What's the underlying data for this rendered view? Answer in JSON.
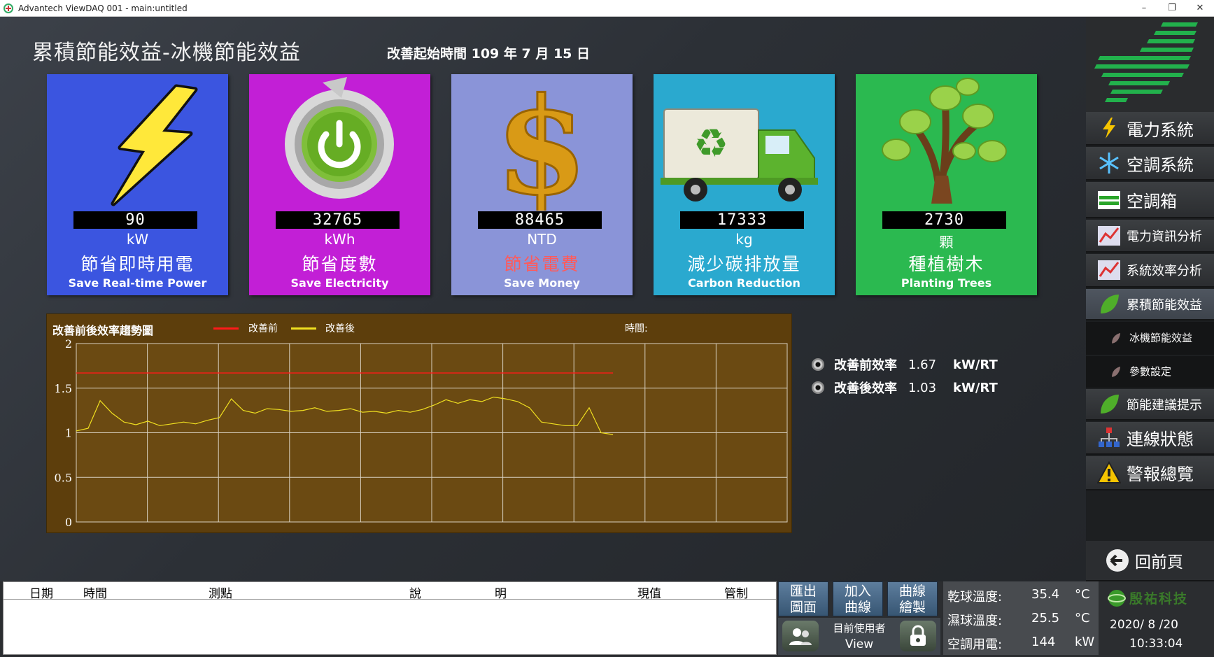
{
  "window": {
    "title": "Advantech ViewDAQ 001 - main:untitled",
    "minimize": "–",
    "restore": "❐",
    "close": "✕"
  },
  "header": {
    "title": "累積節能效益-冰機節能效益",
    "start_label": "改善起始時間 109 年 7 月 15 日"
  },
  "cards": [
    {
      "value": "90",
      "unit": "kW",
      "zh": "節省即時用電",
      "en": "Save Real-time Power",
      "color": "#3b55e0",
      "icon": "lightning-bolt-icon"
    },
    {
      "value": "32765",
      "unit": "kWh",
      "zh": "節省度數",
      "en": "Save Electricity",
      "color": "#c21fd6",
      "icon": "power-button-icon"
    },
    {
      "value": "88465",
      "unit": "NTD",
      "zh": "節省電費",
      "en": "Save Money",
      "color": "#8a94d8",
      "icon": "dollar-icon"
    },
    {
      "value": "17333",
      "unit": "kg",
      "zh": "減少碳排放量",
      "en": "Carbon Reduction",
      "color": "#2aa9cf",
      "icon": "recycle-truck-icon"
    },
    {
      "value": "2730",
      "unit": "顆",
      "zh": "種植樹木",
      "en": "Planting Trees",
      "color": "#2bb950",
      "icon": "tree-icon"
    }
  ],
  "chart_data": {
    "type": "line",
    "title": "改善前後效率趨勢圖",
    "time_label": "時間:",
    "ylim": [
      0,
      2
    ],
    "yticks": [
      "0",
      "0.5",
      "1",
      "1.5",
      "2"
    ],
    "series": [
      {
        "name": "改善前",
        "color": "#ff1a1a",
        "values": [
          1.67,
          1.67,
          1.67,
          1.67,
          1.67,
          1.67,
          1.67,
          1.67,
          1.67,
          1.67,
          1.67,
          1.67,
          1.67,
          1.67,
          1.67,
          1.67,
          1.67,
          1.67,
          1.67,
          1.67,
          1.67,
          1.67,
          1.67,
          1.67,
          1.67,
          1.67,
          1.67,
          1.67,
          1.67,
          1.67,
          1.67,
          1.67,
          1.67,
          1.67,
          1.67,
          1.67,
          1.67,
          1.67,
          1.67,
          1.67,
          1.67,
          1.67,
          1.67,
          1.67,
          1.67,
          1.67
        ]
      },
      {
        "name": "改善後",
        "color": "#f0e020",
        "values": [
          1.02,
          1.05,
          1.36,
          1.22,
          1.12,
          1.09,
          1.13,
          1.08,
          1.1,
          1.12,
          1.1,
          1.14,
          1.17,
          1.38,
          1.25,
          1.22,
          1.27,
          1.26,
          1.24,
          1.25,
          1.28,
          1.24,
          1.25,
          1.27,
          1.23,
          1.24,
          1.22,
          1.25,
          1.23,
          1.26,
          1.31,
          1.37,
          1.33,
          1.37,
          1.35,
          1.4,
          1.38,
          1.35,
          1.28,
          1.12,
          1.1,
          1.08,
          1.08,
          1.28,
          1.0,
          0.98
        ]
      }
    ]
  },
  "efficiency": [
    {
      "label": "改善前效率",
      "value": "1.67",
      "unit": "kW/RT"
    },
    {
      "label": "改善後效率",
      "value": "1.03",
      "unit": "kW/RT"
    }
  ],
  "sidebar": {
    "items": [
      {
        "label": "電力系統",
        "icon": "lightning-icon",
        "size": "24px"
      },
      {
        "label": "空調系統",
        "icon": "snowflake-icon",
        "size": "24px"
      },
      {
        "label": "空調箱",
        "icon": "ahu-icon",
        "size": "24px"
      },
      {
        "label": "電力資訊分析",
        "icon": "analysis-chart-icon",
        "size": "18px"
      },
      {
        "label": "系統效率分析",
        "icon": "efficiency-chart-icon",
        "size": "18px"
      },
      {
        "label": "累積節能效益",
        "icon": "leaf-icon",
        "size": "18px",
        "active": true
      },
      {
        "label": "冰機節能效益",
        "icon": "leaf-small-icon",
        "size": "15px",
        "sub": true
      },
      {
        "label": "參數設定",
        "icon": "leaf-small-icon",
        "size": "15px",
        "sub": true
      },
      {
        "label": "節能建議提示",
        "icon": "leaf-icon",
        "size": "18px"
      },
      {
        "label": "連線狀態",
        "icon": "network-icon",
        "size": "24px"
      },
      {
        "label": "警報總覽",
        "icon": "warning-icon",
        "size": "24px"
      }
    ],
    "back": "回前頁"
  },
  "log_table": {
    "headers": [
      "日期",
      "時間",
      "測點",
      "說",
      "明",
      "現值",
      "管制"
    ]
  },
  "buttons": {
    "export": [
      "匯出",
      "圖面"
    ],
    "add_curve": [
      "加入",
      "曲線"
    ],
    "draw_curve": [
      "曲線",
      "繪製"
    ]
  },
  "user": {
    "label": "目前使用者",
    "name": "View"
  },
  "readings": [
    {
      "label": "乾球溫度:",
      "value": "35.4",
      "unit": "°C"
    },
    {
      "label": "濕球溫度:",
      "value": "25.5",
      "unit": "°C"
    },
    {
      "label": "空調用電:",
      "value": "144",
      "unit": "kW"
    }
  ],
  "brand": "殷祐科技",
  "clock": {
    "date": "2020/ 8 /20",
    "time": "10:33:04"
  }
}
